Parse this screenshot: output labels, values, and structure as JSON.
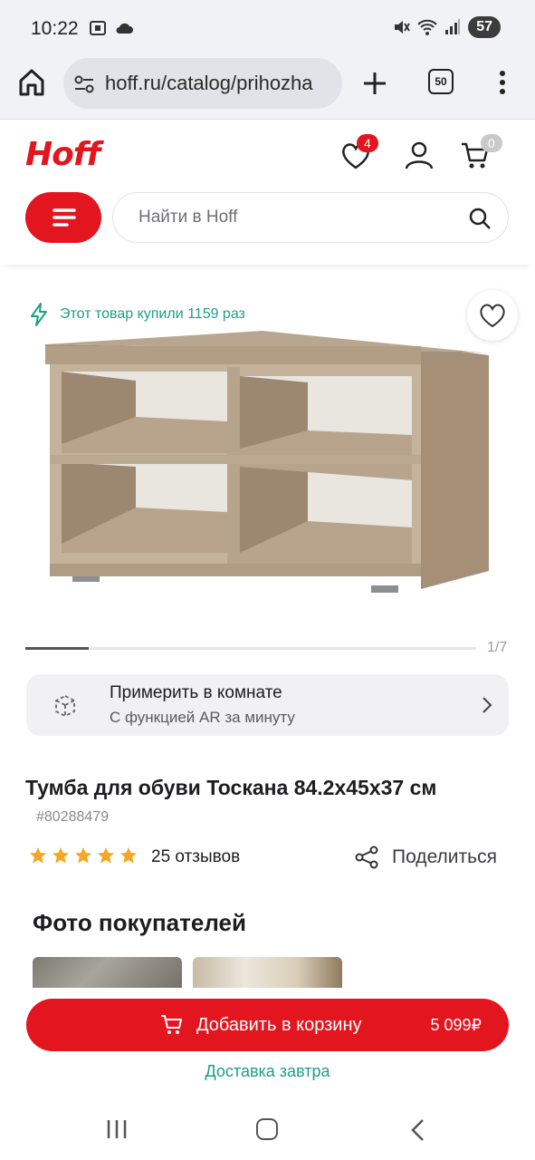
{
  "status_bar": {
    "time": "10:22",
    "battery": "57"
  },
  "browser": {
    "url": "hoff.ru/catalog/prihozha",
    "tab_count": "50"
  },
  "header": {
    "logo": "Hoff",
    "favorites_count": "4",
    "cart_count": "0",
    "search_placeholder": "Найти в Hoff"
  },
  "gallery": {
    "bought_text": "Этот товар купили 1159 раз",
    "slide_counter": "1/7",
    "slide_progress": 0.14
  },
  "ar": {
    "title": "Примерить в комнате",
    "subtitle": "С  функцией AR за минуту"
  },
  "product": {
    "title": "Тумба для обуви Тоскана 84.2x45x37 см",
    "sku": "#80288479",
    "rating_stars": 5,
    "reviews": "25 отзывов",
    "share_label": "Поделиться"
  },
  "photos": {
    "heading": "Фото покупателей"
  },
  "cta": {
    "add_to_cart": "Добавить в корзину",
    "price": "5 099₽",
    "delivery": "Доставка завтра"
  },
  "colors": {
    "brand": "#e3151f",
    "accent_green": "#1e9f86",
    "star": "#f5a623"
  }
}
